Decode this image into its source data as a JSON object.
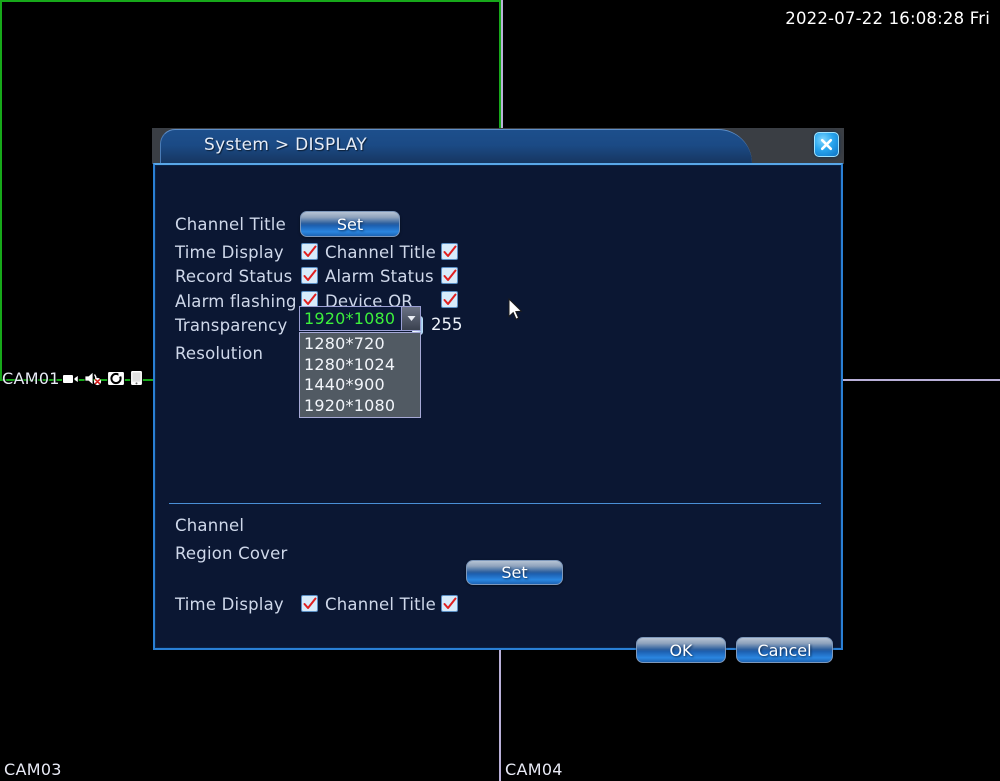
{
  "overlay": {
    "datetime": "2022-07-22 16:08:28 Fri",
    "cameras": [
      {
        "name": "CAM01",
        "border_color": "#17a81a",
        "icons": [
          "video-camera-icon",
          "muted-speaker-icon",
          "record-circle-icon",
          "device-mobile-icon"
        ]
      },
      {
        "name": "CAM03",
        "border_color": "#b9b0d8",
        "icons": []
      },
      {
        "name": "CAM04",
        "border_color": "#b9b0d8",
        "icons": []
      }
    ]
  },
  "dialog": {
    "title": "System > DISPLAY",
    "close_label": "×",
    "rows": {
      "channel_title": {
        "label": "Channel Title",
        "button": "Set"
      },
      "time_display": {
        "label": "Time Display",
        "checked": true,
        "right_label": "Channel Title",
        "right_checked": true
      },
      "record_status": {
        "label": "Record Status",
        "checked": true,
        "right_label": "Alarm Status",
        "right_checked": true
      },
      "alarm_flashing": {
        "label": "Alarm flashing",
        "checked": true,
        "right_label": "Device QR",
        "right_checked": true
      },
      "transparency": {
        "label": "Transparency",
        "value": "255",
        "percent": 100
      },
      "resolution": {
        "label": "Resolution",
        "value": "1920*1080",
        "options": [
          "1280*720",
          "1280*1024",
          "1440*900",
          "1920*1080"
        ]
      },
      "channel": {
        "label": "Channel"
      },
      "region_cover": {
        "label": "Region Cover"
      },
      "time_display2": {
        "label": "Time Display",
        "checked": true,
        "right_label": "Channel Title",
        "right_checked": true,
        "button": "Set"
      }
    },
    "footer": {
      "ok": "OK",
      "cancel": "Cancel"
    }
  },
  "colors": {
    "accent_blue": "#2a7fd4",
    "dialog_bg": "#0b1733",
    "combo_value_green": "#3cf03c",
    "check_red": "#e02020",
    "selected_border_green": "#17a81a",
    "grid_line_purple": "#b9b0d8"
  }
}
